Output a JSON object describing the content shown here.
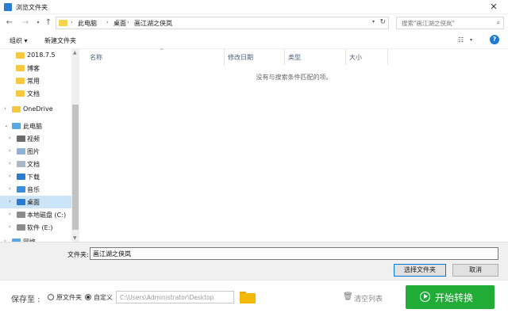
{
  "window": {
    "title": "浏览文件夹",
    "close_glyph": "✕"
  },
  "address": {
    "crumbs": [
      "此电脑",
      "桌面",
      "画江湖之侠岚"
    ],
    "search_placeholder": "搜索\"画江湖之侠岚\""
  },
  "toolbar": {
    "organize": "组织 ▾",
    "new_folder": "新建文件夹",
    "help": "?"
  },
  "nav_items": [
    {
      "label": "2018.7.5",
      "icon": "folder-icon",
      "indent": 2
    },
    {
      "label": "博客",
      "icon": "folder-icon",
      "indent": 2
    },
    {
      "label": "常用",
      "icon": "folder-icon",
      "indent": 2
    },
    {
      "label": "文档",
      "icon": "folder-icon",
      "indent": 2
    },
    {
      "label": "OneDrive",
      "icon": "folder-icon",
      "indent": 0
    },
    {
      "label": "此电脑",
      "icon": "computer-icon",
      "indent": 0
    },
    {
      "label": "视频",
      "icon": "video-icon",
      "indent": 1
    },
    {
      "label": "图片",
      "icon": "picture-icon",
      "indent": 1
    },
    {
      "label": "文档",
      "icon": "document-icon",
      "indent": 1
    },
    {
      "label": "下载",
      "icon": "download-icon",
      "indent": 1
    },
    {
      "label": "音乐",
      "icon": "music-icon",
      "indent": 1
    },
    {
      "label": "桌面",
      "icon": "desktop-icon",
      "indent": 1,
      "selected": true
    },
    {
      "label": "本地磁盘 (C:)",
      "icon": "drive-icon",
      "indent": 1
    },
    {
      "label": "软件 (E:)",
      "icon": "drive-icon",
      "indent": 1
    },
    {
      "label": "网络",
      "icon": "network-icon",
      "indent": 0
    }
  ],
  "columns": [
    "名称",
    "修改日期",
    "类型",
    "大小"
  ],
  "empty_message": "没有与搜索条件匹配的项。",
  "folder_field": {
    "label": "文件夹:",
    "value": "画江湖之侠岚"
  },
  "buttons": {
    "select": "选择文件夹",
    "cancel": "取消"
  },
  "app": {
    "save_to": "保存至 :",
    "original_folder": "原文件夹",
    "custom": "自定义",
    "path": "C:\\Users\\Administrator\\Desktop",
    "clear_list": "清空列表",
    "convert": "开始转换"
  },
  "colors": {
    "convert_green": "#21ac37",
    "selection_blue": "#cce4f7",
    "help_blue": "#1f7ad6",
    "folder_yellow": "#f5b800"
  }
}
